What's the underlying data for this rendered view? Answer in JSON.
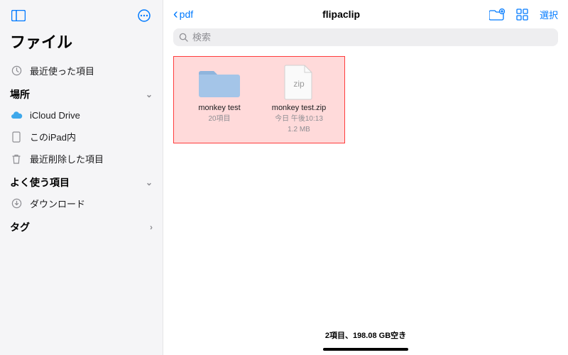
{
  "sidebar": {
    "app_title": "ファイル",
    "recents": "最近使った項目",
    "locations_header": "場所",
    "items": [
      {
        "label": "iCloud Drive"
      },
      {
        "label": "このiPad内"
      },
      {
        "label": "最近削除した項目"
      }
    ],
    "favorites_header": "よく使う項目",
    "favorites": [
      {
        "label": "ダウンロード"
      }
    ],
    "tags_header": "タグ"
  },
  "toolbar": {
    "back_label": "pdf",
    "title": "flipaclip",
    "select_label": "選択"
  },
  "search": {
    "placeholder": "検索"
  },
  "files": [
    {
      "name": "monkey test",
      "meta1": "20項目",
      "meta2": ""
    },
    {
      "name": "monkey test.zip",
      "meta1": "今日 午後10:13",
      "meta2": "1.2 MB"
    }
  ],
  "status": "2項目、198.08 GB空き"
}
